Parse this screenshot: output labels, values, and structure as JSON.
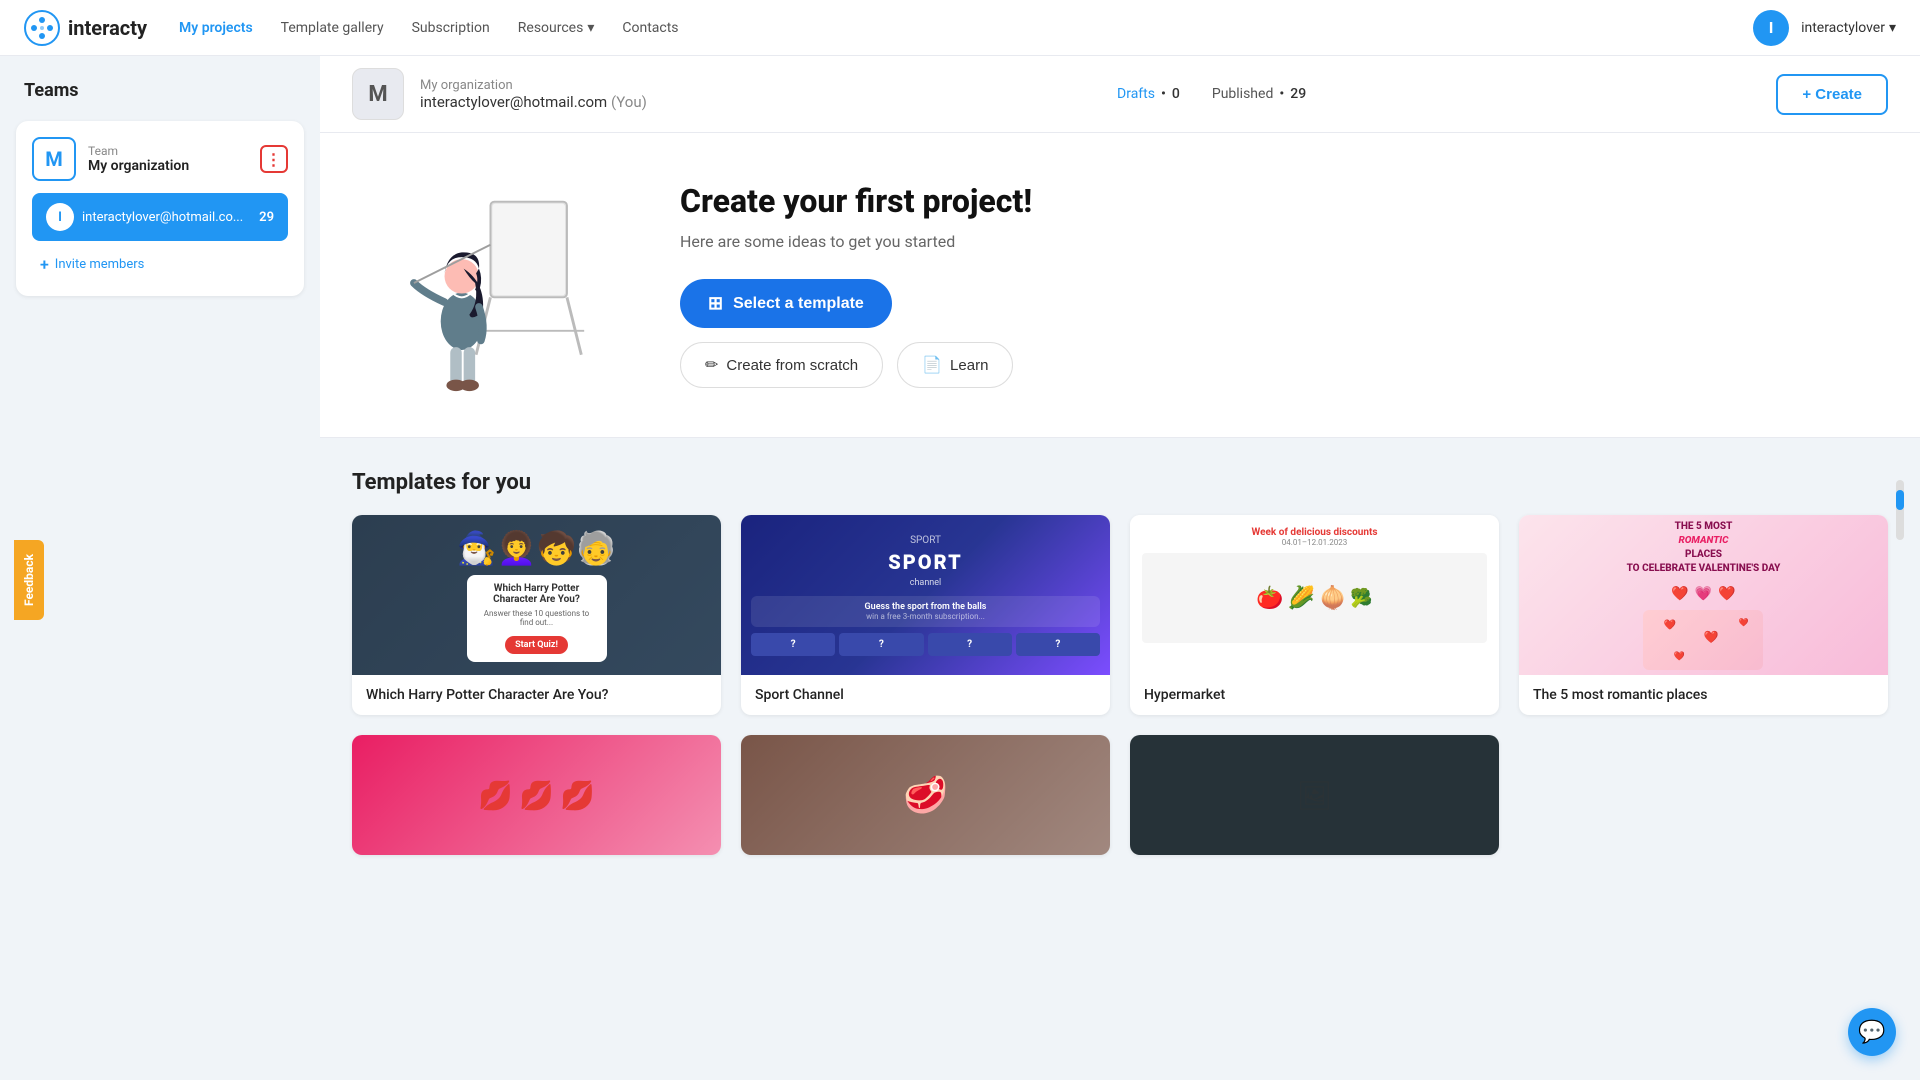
{
  "header": {
    "logo_text": "interacty",
    "nav": [
      {
        "id": "my-projects",
        "label": "My projects",
        "active": true
      },
      {
        "id": "template-gallery",
        "label": "Template gallery",
        "active": false
      },
      {
        "id": "subscription",
        "label": "Subscription",
        "active": false
      },
      {
        "id": "resources",
        "label": "Resources",
        "active": false,
        "has_dropdown": true
      },
      {
        "id": "contacts",
        "label": "Contacts",
        "active": false
      }
    ],
    "user_initial": "I",
    "user_name": "interactylover",
    "user_dropdown": true
  },
  "sidebar": {
    "title": "Teams",
    "team": {
      "avatar_letter": "M",
      "label": "Team",
      "name": "My organization"
    },
    "member": {
      "initial": "I",
      "email": "interactylover@hotmail.co...",
      "count": "29"
    },
    "invite_label": "Invite members"
  },
  "org_bar": {
    "avatar_letter": "M",
    "org_name": "My organization",
    "email": "interactylover@hotmail.com",
    "you_label": "(You)",
    "drafts_label": "Drafts",
    "drafts_count": "0",
    "published_label": "Published",
    "published_count": "29",
    "create_btn": "+ Create"
  },
  "hero": {
    "title": "Create your first project!",
    "subtitle": "Here are some ideas to get you started",
    "btn_template": "Select a template",
    "btn_scratch": "Create from scratch",
    "btn_learn": "Learn"
  },
  "templates_section": {
    "title": "Templates for you",
    "cards": [
      {
        "id": "hp",
        "name": "Which Harry Potter Character Are You?",
        "thumb_type": "hp"
      },
      {
        "id": "sport",
        "name": "Sport Channel",
        "thumb_type": "sport"
      },
      {
        "id": "hyper",
        "name": "Hypermarket",
        "thumb_type": "hyper"
      },
      {
        "id": "romantic",
        "name": "The 5 most romantic places",
        "thumb_type": "romantic"
      }
    ],
    "bottom_cards": [
      {
        "id": "lips",
        "name": "",
        "thumb_type": "lips"
      },
      {
        "id": "food2",
        "name": "",
        "thumb_type": "food2"
      },
      {
        "id": "dark",
        "name": "",
        "thumb_type": "dark"
      }
    ]
  },
  "feedback": {
    "label": "Feedback"
  },
  "colors": {
    "primary": "#2196f3",
    "accent": "#f5a623"
  }
}
